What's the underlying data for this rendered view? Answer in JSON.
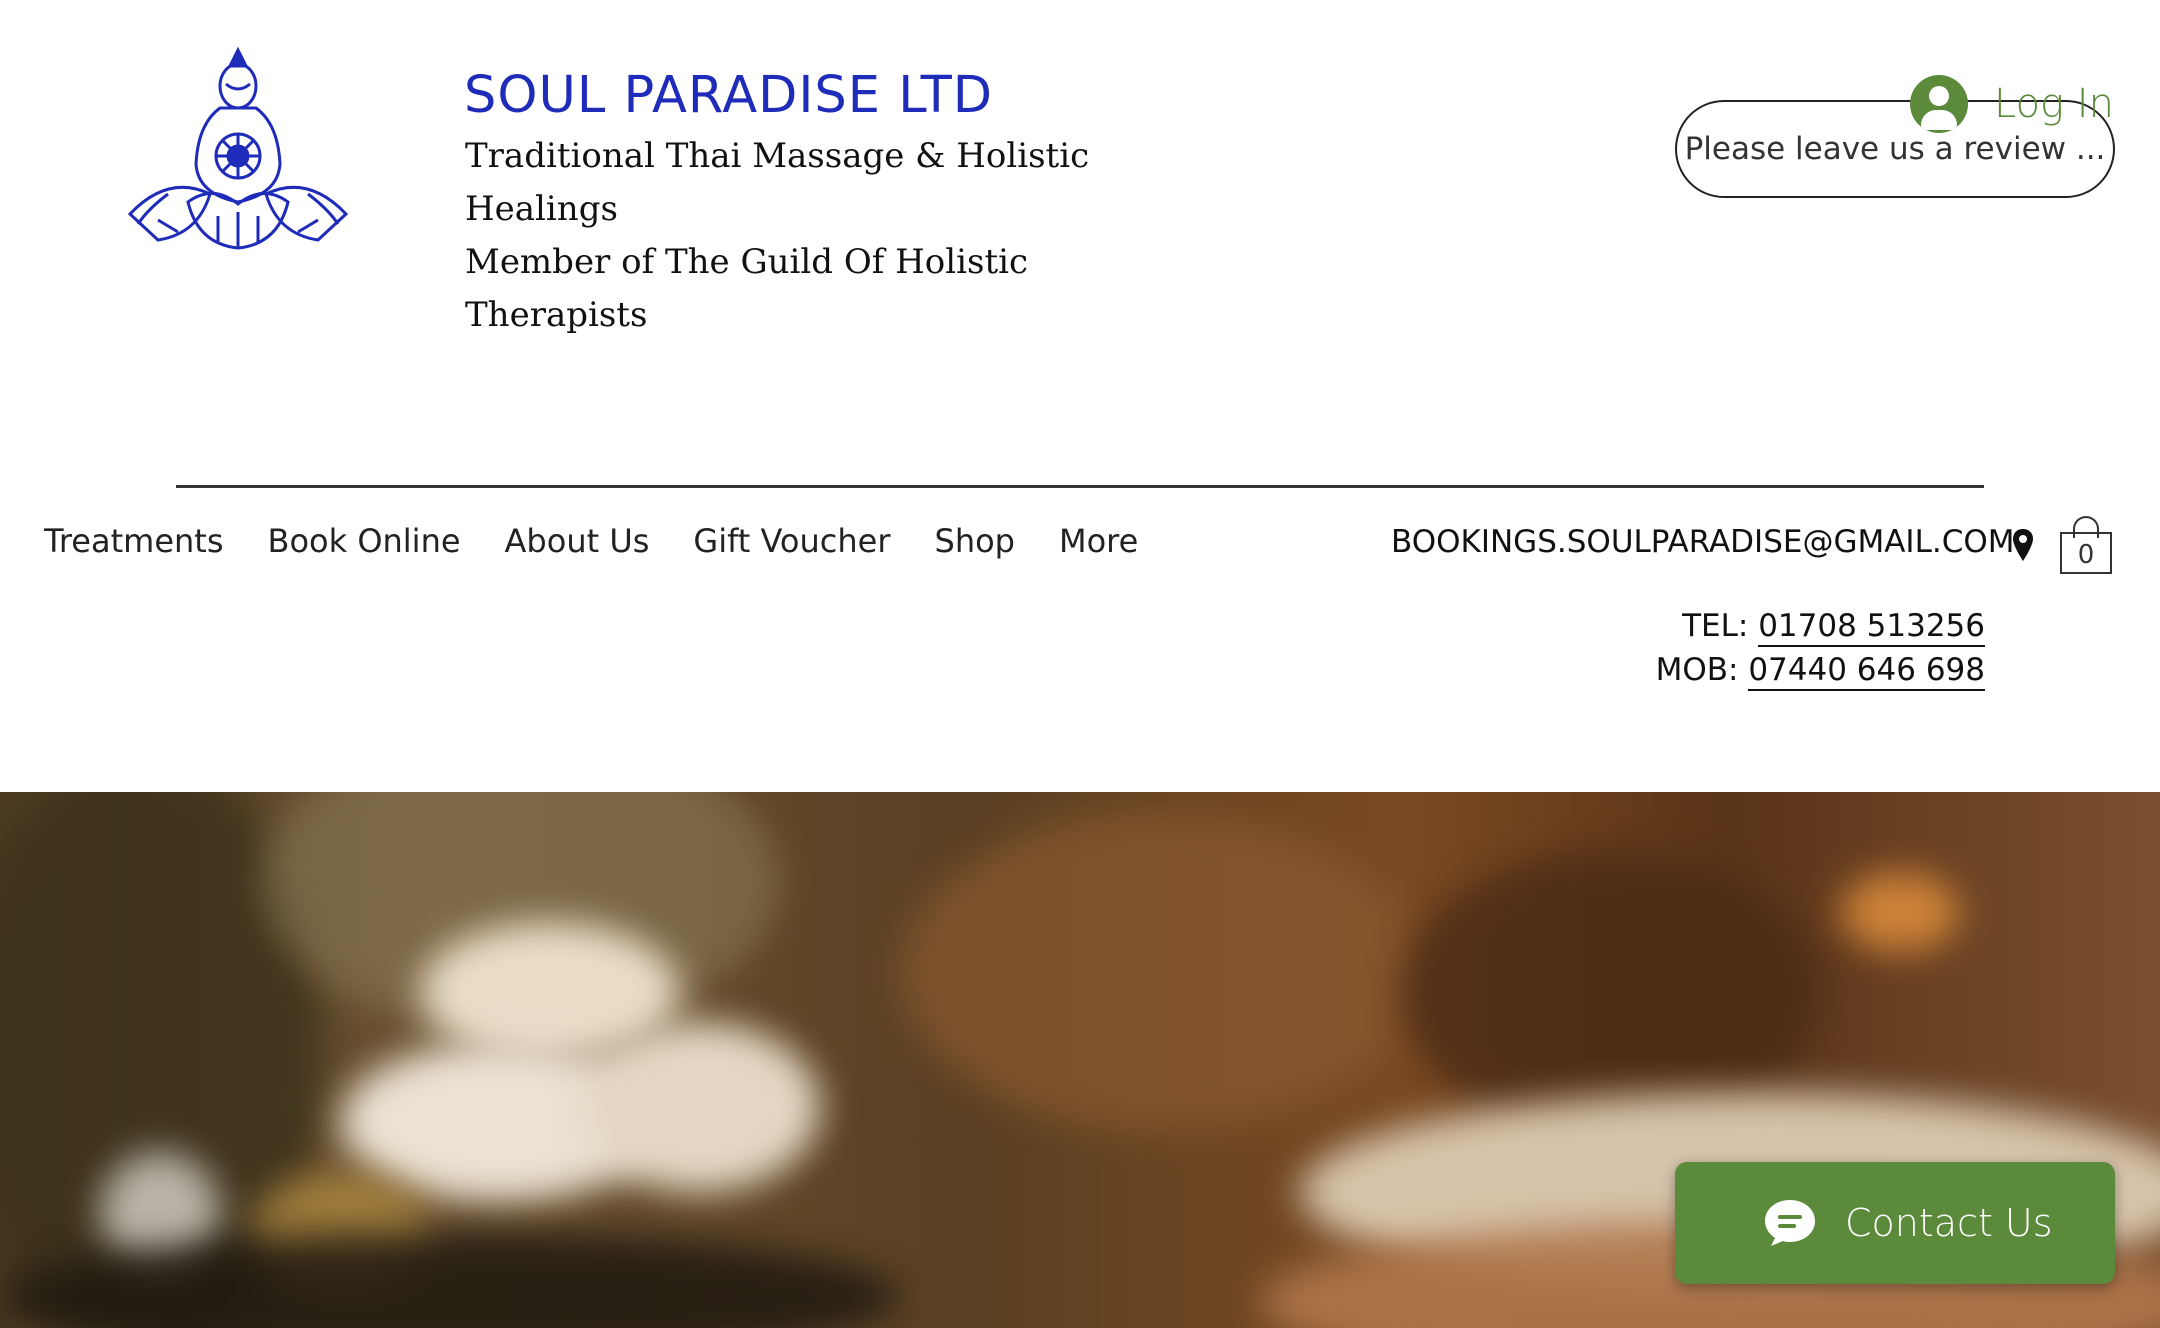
{
  "header": {
    "brand_title": "SOUL PARADISE LTD",
    "tagline_lines": [
      "Traditional Thai Massage & Holistic",
      "Healings",
      "Member of The Guild Of Holistic",
      "Therapists"
    ],
    "login_label": "Log In",
    "review_button_label": "Please leave us a review ..."
  },
  "nav": {
    "items": [
      "Treatments",
      "Book Online",
      "About Us",
      "Gift Voucher",
      "Shop",
      "More"
    ]
  },
  "contact": {
    "email": "BOOKINGS.SOULPARADISE@GMAIL.COM",
    "tel_label": "TEL: ",
    "tel_number": "01708 513256",
    "mob_label": "MOB: ",
    "mob_number": "07440 646 698"
  },
  "cart": {
    "count": "0"
  },
  "widget": {
    "contact_label": "Contact Us"
  },
  "icons": {
    "logo": "buddha-lotus-logo",
    "login": "user-avatar-icon",
    "location": "map-pin-icon",
    "cart": "shopping-bag-icon",
    "chat": "chat-bubble-icon"
  },
  "colors": {
    "brand_blue": "#1f2bb9",
    "accent_green": "#5a8a3a",
    "text": "#111111"
  }
}
